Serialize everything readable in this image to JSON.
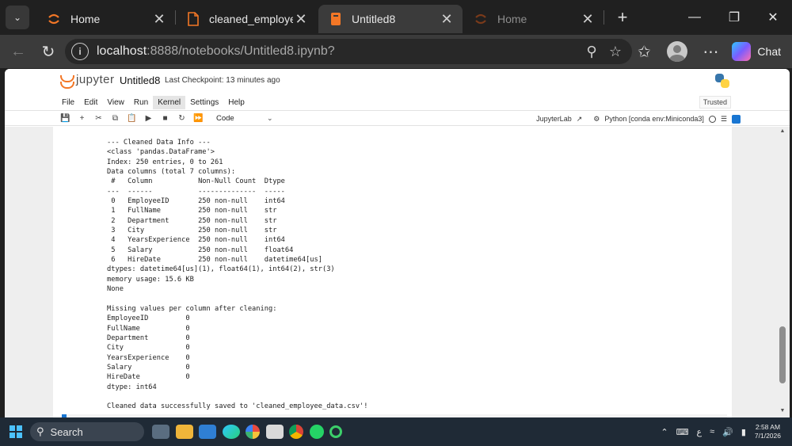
{
  "browser": {
    "tabs": [
      {
        "label": "Home",
        "icon": "jupyter-icon",
        "state": "normal"
      },
      {
        "label": "cleaned_employee_d",
        "icon": "file-icon",
        "state": "normal"
      },
      {
        "label": "Untitled8",
        "icon": "notebook-icon",
        "state": "active"
      },
      {
        "label": "Home",
        "icon": "jupyter-icon",
        "state": "dim"
      }
    ],
    "url_host": "localhost",
    "url_path": ":8888/notebooks/Untitled8.ipynb?",
    "chat_label": "Chat"
  },
  "jupyter": {
    "brand": "jupyter",
    "notebook_name": "Untitled8",
    "checkpoint": "Last Checkpoint: 13 minutes ago",
    "menu": [
      "File",
      "Edit",
      "View",
      "Run",
      "Kernel",
      "Settings",
      "Help"
    ],
    "active_menu": "Kernel",
    "trusted": "Trusted",
    "cell_type": "Code",
    "jupyterlab_link": "JupyterLab",
    "kernel_label": "Python [conda env:Miniconda3]"
  },
  "output_lines": [
    "--- Cleaned Data Info ---",
    "<class 'pandas.DataFrame'>",
    "Index: 250 entries, 0 to 261",
    "Data columns (total 7 columns):",
    " #   Column           Non-Null Count  Dtype",
    "---  ------           --------------  -----",
    " 0   EmployeeID       250 non-null    int64",
    " 1   FullName         250 non-null    str",
    " 2   Department       250 non-null    str",
    " 3   City             250 non-null    str",
    " 4   YearsExperience  250 non-null    int64",
    " 5   Salary           250 non-null    float64",
    " 6   HireDate         250 non-null    datetime64[us]",
    "dtypes: datetime64[us](1), float64(1), int64(2), str(3)",
    "memory usage: 15.6 KB",
    "None",
    "",
    "Missing values per column after cleaning:",
    "EmployeeID         0",
    "FullName           0",
    "Department         0",
    "City               0",
    "YearsExperience    0",
    "Salary             0",
    "HireDate           0",
    "dtype: int64",
    "",
    "Cleaned data successfully saved to 'cleaned_employee_data.csv'!"
  ],
  "taskbar": {
    "search_label": "Search",
    "tray_lang": "ع",
    "time": "2:58 AM",
    "date": "7/1/2026"
  }
}
